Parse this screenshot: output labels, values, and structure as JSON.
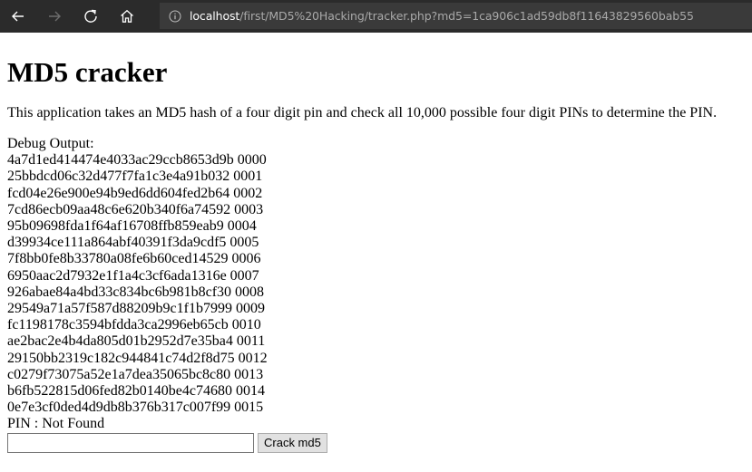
{
  "browser": {
    "url_host": "localhost",
    "url_path": "/first/MD5%20Hacking/tracker.php?md5=1ca906c1ad59db8f11643829560bab55"
  },
  "page": {
    "title": "MD5 cracker",
    "description": "This application takes an MD5 hash of a four digit pin and check all 10,000 possible four digit PINs to determine the PIN.",
    "debug_label": "Debug Output:",
    "debug_lines": [
      "4a7d1ed414474e4033ac29ccb8653d9b 0000",
      "25bbdcd06c32d477f7fa1c3e4a91b032 0001",
      "fcd04e26e900e94b9ed6dd604fed2b64 0002",
      "7cd86ecb09aa48c6e620b340f6a74592 0003",
      "95b09698fda1f64af16708ffb859eab9 0004",
      "d39934ce111a864abf40391f3da9cdf5 0005",
      "7f8bb0fe8b33780a08fe6b60ced14529 0006",
      "6950aac2d7932e1f1a4c3cf6ada1316e 0007",
      "926abae84a4bd33c834bc6b981b8cf30 0008",
      "29549a71a57f587d88209b9c1f1b7999 0009",
      "fc1198178c3594bfdda3ca2996eb65cb 0010",
      "ae2bac2e4b4da805d01b2952d7e35ba4 0011",
      "29150bb2319c182c944841c74d2f8d75 0012",
      "c0279f73075a52e1a7dea35065bc8c80 0013",
      "b6fb522815d06fed82b0140be4c74680 0014",
      "0e7e3cf0ded4d9db8b376b317c007f99 0015"
    ],
    "pin_result": "PIN : Not Found",
    "md5_input_value": "",
    "crack_button_label": "Crack md5"
  }
}
